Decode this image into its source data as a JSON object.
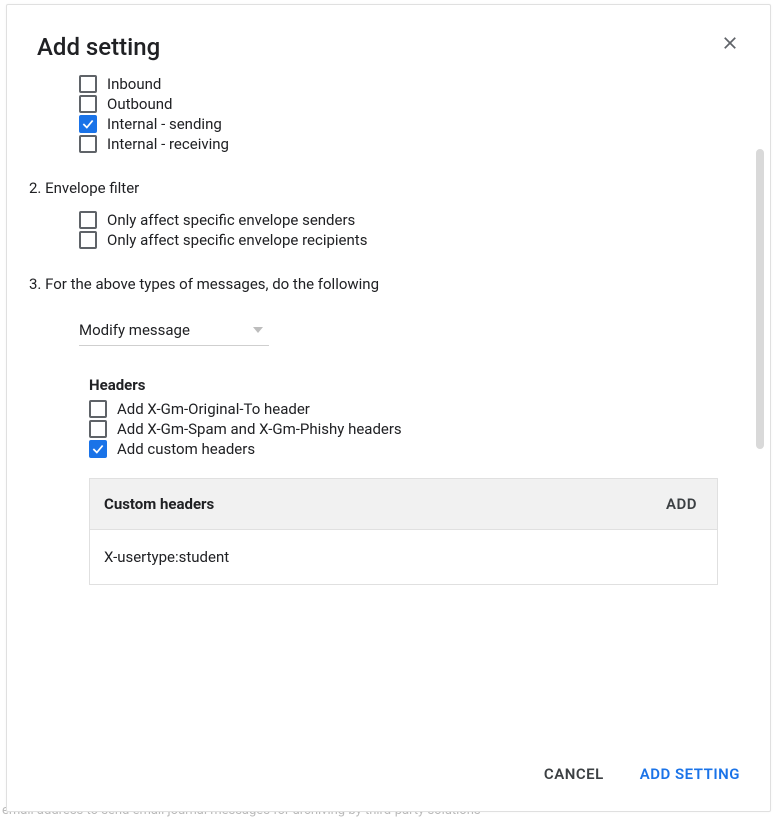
{
  "backdrop_text": "email address to send email journal messages for archiving by third-party solutions",
  "dialog": {
    "title": "Add setting",
    "section1_checkboxes": [
      {
        "label": "Inbound",
        "checked": false
      },
      {
        "label": "Outbound",
        "checked": false
      },
      {
        "label": "Internal - sending",
        "checked": true
      },
      {
        "label": "Internal - receiving",
        "checked": false
      }
    ],
    "section2": {
      "heading": "2. Envelope filter",
      "options": [
        {
          "label": "Only affect specific envelope senders",
          "checked": false
        },
        {
          "label": "Only affect specific envelope recipients",
          "checked": false
        }
      ]
    },
    "section3": {
      "heading": "3. For the above types of messages, do the following",
      "action_select": "Modify message",
      "headers_subhead": "Headers",
      "header_options": [
        {
          "label": "Add X-Gm-Original-To header",
          "checked": false
        },
        {
          "label": "Add X-Gm-Spam and X-Gm-Phishy headers",
          "checked": false
        },
        {
          "label": "Add custom headers",
          "checked": true
        }
      ],
      "custom_headers": {
        "title": "Custom headers",
        "add_label": "ADD",
        "rows": [
          "X-usertype:student"
        ]
      }
    },
    "footer": {
      "cancel": "CANCEL",
      "submit": "ADD SETTING"
    }
  }
}
